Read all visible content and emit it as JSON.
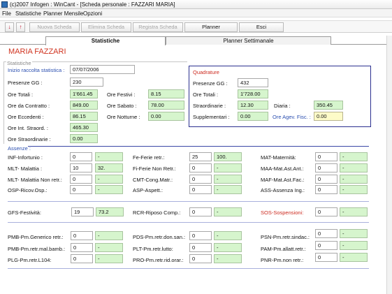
{
  "window": {
    "title": "(c)2007 Infogen : WinCant - [Scheda personale : FAZZARI MARIA]"
  },
  "menu": [
    "File",
    "Statistiche",
    "Planner Mensile",
    "Opzioni"
  ],
  "toolbar": {
    "down_arrow": "↓",
    "up_arrow": "↑",
    "nuova": "Nuova Scheda",
    "elimina": "Elimina Scheda",
    "registra": "Registra Scheda",
    "planner": "Planner",
    "esci": "Esci"
  },
  "tabs": [
    "Statistiche",
    "Planner Settimanale"
  ],
  "person": {
    "name": "MARIA FAZZARI"
  },
  "stats": {
    "frame_label": "Statistiche",
    "inizio_label": "Inizio raccolta statistica :",
    "inizio_value": "07/07/2006",
    "presenze_label": "Presenze GG :",
    "presenze_value": "230",
    "ore_totali_label": "Ore Totali :",
    "ore_totali_value": "1'661.45",
    "ore_contratto_label": "Ore da Contratto :",
    "ore_contratto_value": "849.00",
    "ore_eccedenti_label": "Ore Eccedenti :",
    "ore_eccedenti_value": "86.15",
    "ore_int_label": "Ore Int. Straord. :",
    "ore_int_value": "465.30",
    "ore_straord_label": "Ore Straordinarie :",
    "ore_straord_value": "0.00",
    "ore_festivi_label": "Ore Festivi :",
    "ore_festivi_value": "8.15",
    "ore_sabato_label": "Ore Sabato :",
    "ore_sabato_value": "78.00",
    "ore_notturne_label": "Ore Notturne :",
    "ore_notturne_value": "0.00"
  },
  "quadrature": {
    "title": "Quadrature",
    "presenze_label": "Presenze GG :",
    "presenze_value": "432",
    "ore_totali_label": "Ore Totali :",
    "ore_totali_value": "1'728.00",
    "straord_label": "Straordinarie :",
    "straord_value": "12.30",
    "diaria_label": "Diaria :",
    "diaria_value": "350.45",
    "suppl_label": "Supplementari :",
    "suppl_value": "0.00",
    "agev_label": "Ore Agev. Fisc. :",
    "agev_value": "0.00"
  },
  "assenze": {
    "title": "Assenze :",
    "rows": [
      {
        "label": "INF-Infortunio :",
        "a": "0",
        "b": "-"
      },
      {
        "label": "MLT- Malattia :",
        "a": "10",
        "b": "32."
      },
      {
        "label": "MLT- Malattia Non retr.:",
        "a": "0",
        "b": "-"
      },
      {
        "label": "OSP-Ricov.Osp.:",
        "a": "0",
        "b": "-"
      },
      {
        "label": "Fe-Ferie retr.:",
        "a": "25",
        "b": "100."
      },
      {
        "label": "Fi-Ferie Non Retr.:",
        "a": "0",
        "b": "-"
      },
      {
        "label": "CMT-Cong.Matr.:",
        "a": "0",
        "b": "-"
      },
      {
        "label": "ASP-Aspett.:",
        "a": "0",
        "b": "-"
      },
      {
        "label": "MAT-Maternità:",
        "a": "0",
        "b": "-"
      },
      {
        "label": "MAA-Mat.Ast.Ant.:",
        "a": "0",
        "b": "-"
      },
      {
        "label": "MAF-Mat.Ast.Fac.:",
        "a": "0",
        "b": "-"
      },
      {
        "label": "ASS-Assenza Ing.:",
        "a": "0",
        "b": "-"
      }
    ],
    "gfs_label": "GFS-Festività:",
    "gfs_a": "19",
    "gfs_b": "73.2",
    "rcr_label": "RCR-Riposo Comp.:",
    "rcr_a": "0",
    "rcr_b": "-",
    "sos_label": "SOS-Sospensioni:",
    "sos_a": "0",
    "sos_b": "-",
    "perm": [
      {
        "label": "PMB-Pm.Generico retr.:",
        "a": "0",
        "b": "-"
      },
      {
        "label": "PMB-Pm.retr.mal.bamb.:",
        "a": "0",
        "b": "-"
      },
      {
        "label": "PLG-Pm.retr.L104:",
        "a": "0",
        "b": "-"
      },
      {
        "label": "PDS-Pm.retr.don.san.:",
        "a": "0",
        "b": "-"
      },
      {
        "label": "PLT-Pm.retr.lutto:",
        "a": "0",
        "b": "-"
      },
      {
        "label": "PRO-Pm.retr.rid.orar.:",
        "a": "0",
        "b": "-"
      },
      {
        "label": "PSN-Pm.retr.sindac.:",
        "a": "0",
        "b": "-"
      },
      {
        "label": "PAM-Pm.allatt.retr.:",
        "a": "0",
        "b": "-"
      },
      {
        "label": "PNR-Pm.non retr.:",
        "a": "0",
        "b": "-"
      }
    ]
  },
  "colors": {
    "accent_red": "#cc2a1f",
    "accent_blue": "#2b4fb0",
    "green_field": "#d6f5cd",
    "yellow_field": "#fdfbc8"
  }
}
